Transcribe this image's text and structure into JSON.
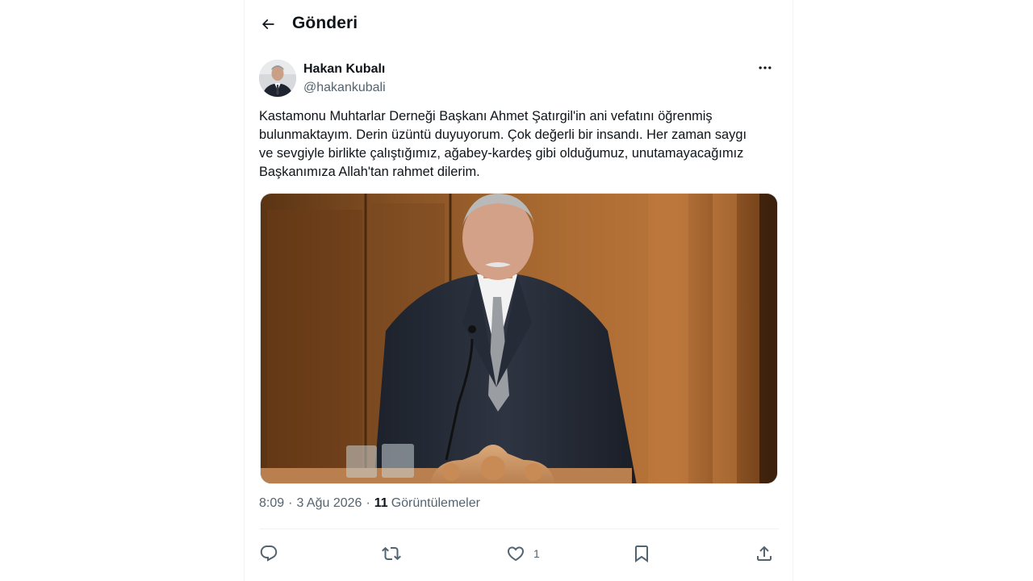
{
  "header": {
    "title": "Gönderi"
  },
  "post": {
    "author": {
      "display_name": "Hakan Kubalı",
      "handle": "@hakankubali"
    },
    "text": "Kastamonu Muhtarlar Derneği Başkanı Ahmet Şatırgil'in ani vefatını öğrenmiş\nbulunmaktayım. Derin üzüntü duyuyorum. Çok değerli bir insandı. Her zaman saygı\nve sevgiyle birlikte çalıştığımız, ağabey-kardeş gibi olduğumuz, unutamayacağımız\nBaşkanımıza Allah'tan rahmet dilerim.",
    "time": "8:09",
    "date": "3 Ağu 2026",
    "separator": "·",
    "views_count": "11",
    "views_label": "Görüntülemeler"
  },
  "actions": {
    "reply_count": "",
    "repost_count": "",
    "like_count": "1",
    "bookmark_count": ""
  },
  "icons": {
    "back": "arrow-left-icon",
    "more": "more-horizontal-icon",
    "reply": "reply-icon",
    "repost": "repost-icon",
    "like": "heart-icon",
    "bookmark": "bookmark-icon",
    "share": "share-icon"
  },
  "colors": {
    "text_primary": "#0f1419",
    "text_secondary": "#536471",
    "border": "#eff3f4"
  }
}
